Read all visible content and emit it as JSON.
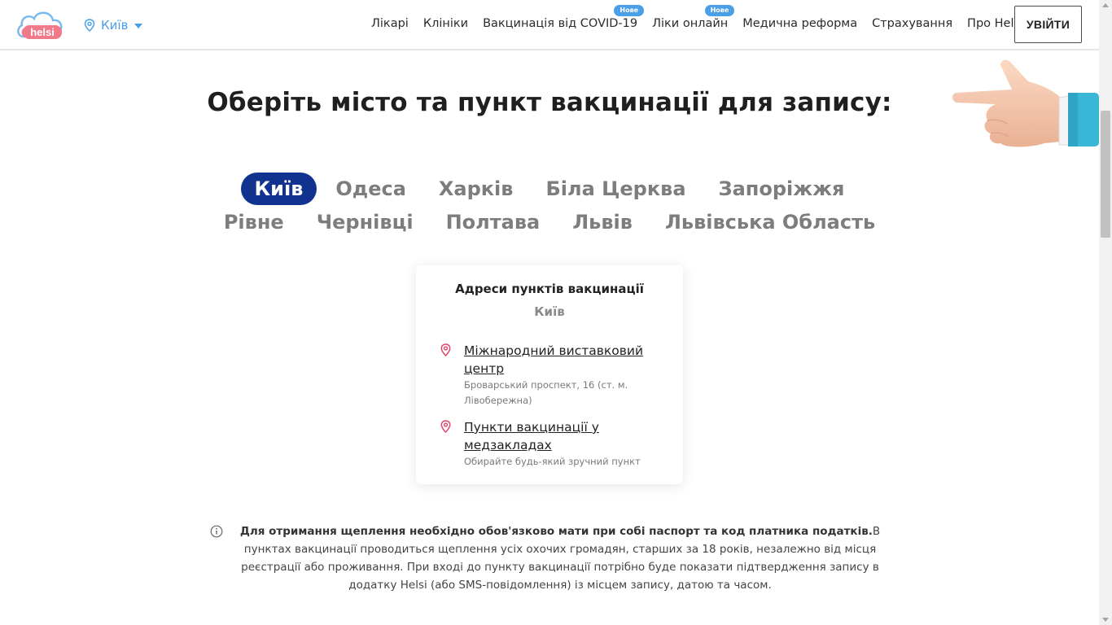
{
  "header": {
    "logo_text": "helsi",
    "city": "Київ",
    "nav": [
      {
        "label": "Лікарі",
        "badge": ""
      },
      {
        "label": "Клініки",
        "badge": ""
      },
      {
        "label": "Вакцинація від COVID-19",
        "badge": "Нове"
      },
      {
        "label": "Ліки онлайн",
        "badge": "Нове"
      },
      {
        "label": "Медична реформа",
        "badge": ""
      },
      {
        "label": "Страхування",
        "badge": ""
      },
      {
        "label": "Про Helsi",
        "badge": ""
      }
    ],
    "login_label": "УВІЙТИ"
  },
  "main": {
    "title": "Оберіть місто та пункт вакцинації для запису:",
    "cities": [
      "Київ",
      "Одеса",
      "Харків",
      "Біла Церква",
      "Запоріжжя",
      "Рівне",
      "Чернівці",
      "Полтава",
      "Львів",
      "Львівська Область"
    ],
    "active_city": "Київ"
  },
  "card": {
    "title": "Адреси пунктів вакцинації",
    "city": "Київ",
    "locations": [
      {
        "name": "Міжнародний виставковий центр",
        "address": "Броварський проспект, 16 (ст. м. Лівобережна)"
      },
      {
        "name": "Пункти вакцинації у медзакладах",
        "address": "Обирайте будь-який зручний пункт"
      }
    ]
  },
  "info": {
    "bold": "Для отримання щеплення необхідно обов'язково мати при собі паспорт та код платника податків.",
    "text": "В пунктах вакцинації проводиться щеплення усіх охочих громадян, старших за 18 років, незалежно від місця реєстрації або проживання. При вході до пункту вакцинації потрібно буде показати підтвердження запису в додатку Helsi (або SMS-повідомлення) із місцем запису, датою та часом."
  },
  "colors": {
    "brand_blue": "#4a9fe6",
    "brand_pink": "#f07a8a",
    "active_city_bg": "#11338f",
    "pin_red": "#e0456a"
  }
}
